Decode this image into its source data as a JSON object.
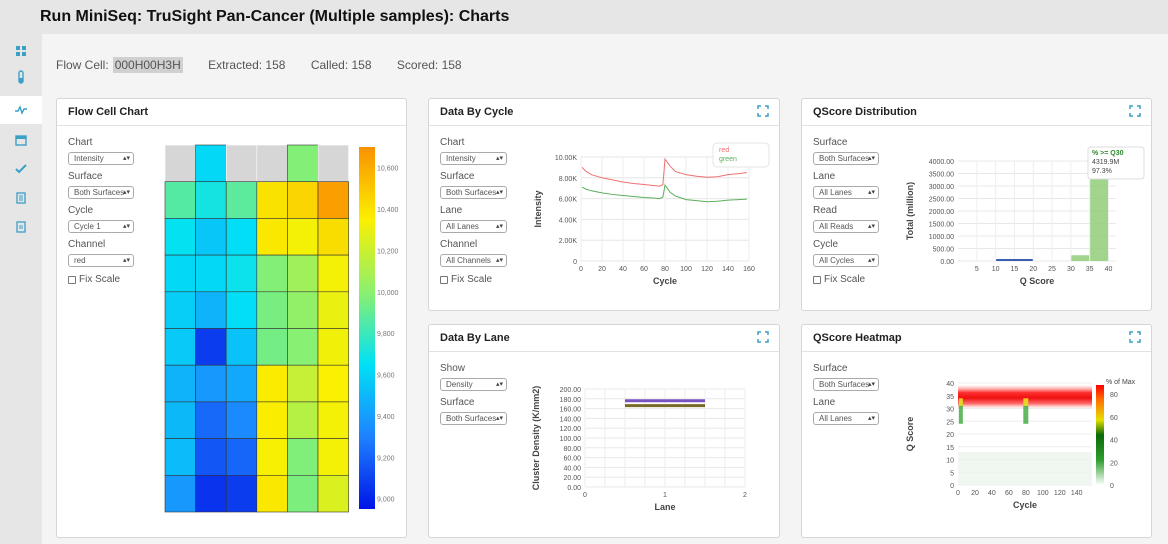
{
  "page": {
    "title": "Run MiniSeq: TruSight Pan-Cancer (Multiple samples): Charts"
  },
  "sidebar": {
    "items": [
      "dashboard-icon",
      "test-tube-icon",
      "charts-icon",
      "calendar-icon",
      "check-icon",
      "notes-icon",
      "document-icon"
    ]
  },
  "summary": {
    "flow_cell_label": "Flow Cell:",
    "flow_cell_value": "000H00H3H",
    "extracted": "Extracted: 158",
    "called": "Called: 158",
    "scored": "Scored: 158"
  },
  "flow_cell_chart": {
    "title": "Flow Cell Chart",
    "chart_label": "Chart",
    "chart_value": "Intensity",
    "surface_label": "Surface",
    "surface_value": "Both Surfaces",
    "cycle_label": "Cycle",
    "cycle_value": "Cycle 1",
    "channel_label": "Channel",
    "channel_value": "red",
    "fix_scale": "Fix Scale"
  },
  "data_by_cycle": {
    "title": "Data By Cycle",
    "chart_label": "Chart",
    "chart_value": "Intensity",
    "surface_label": "Surface",
    "surface_value": "Both Surfaces",
    "lane_label": "Lane",
    "lane_value": "All Lanes",
    "channel_label": "Channel",
    "channel_value": "All Channels",
    "fix_scale": "Fix Scale"
  },
  "qscore_distribution": {
    "title": "QScore Distribution",
    "surface_label": "Surface",
    "surface_value": "Both Surfaces",
    "lane_label": "Lane",
    "lane_value": "All Lanes",
    "read_label": "Read",
    "read_value": "All Reads",
    "cycle_label": "Cycle",
    "cycle_value": "All Cycles",
    "fix_scale": "Fix Scale"
  },
  "data_by_lane": {
    "title": "Data By Lane",
    "show_label": "Show",
    "show_value": "Density",
    "surface_label": "Surface",
    "surface_value": "Both Surfaces"
  },
  "qscore_heatmap": {
    "title": "QScore Heatmap",
    "surface_label": "Surface",
    "surface_value": "Both Surfaces",
    "lane_label": "Lane",
    "lane_value": "All Lanes"
  },
  "colors": {
    "accent": "#3aa0c8",
    "red_series": "#f07070",
    "green_series": "#5cae5c",
    "qscore_bar_low": "#3a5fb0",
    "qscore_bar_high": "#90cc78",
    "lane_series_1": "#7b53c1",
    "lane_series_2": "#7a6a2a"
  },
  "chart_data": [
    {
      "id": "flow_cell_heatmap",
      "type": "heatmap",
      "colorbar_ticks": [
        "10,600",
        "10,400",
        "10,200",
        "10,000",
        "9,800",
        "9,600",
        "9,400",
        "9,200",
        "9,000"
      ],
      "colorbar_range": [
        8950,
        10700
      ],
      "grid": [
        [
          null,
          9620,
          null,
          null,
          9980,
          null
        ],
        [
          9860,
          9700,
          9880,
          10400,
          10450,
          10650
        ],
        [
          9660,
          9550,
          9640,
          10380,
          10330,
          10420
        ],
        [
          9620,
          9620,
          9680,
          9980,
          10060,
          10330
        ],
        [
          9580,
          9480,
          9640,
          9950,
          10020,
          10300
        ],
        [
          9560,
          9080,
          9540,
          9940,
          9990,
          10320
        ],
        [
          9480,
          9380,
          9440,
          10370,
          10180,
          10350
        ],
        [
          9500,
          9220,
          9330,
          10360,
          10130,
          10330
        ],
        [
          9510,
          9160,
          9210,
          10340,
          9970,
          10330
        ],
        [
          9380,
          9050,
          9080,
          10380,
          9960,
          10250
        ]
      ]
    },
    {
      "id": "data_by_cycle",
      "type": "line",
      "xlabel": "Cycle",
      "ylabel": "Intensity",
      "xlim": [
        0,
        160
      ],
      "ylim": [
        0,
        10000
      ],
      "xticks": [
        "0",
        "20",
        "40",
        "60",
        "80",
        "100",
        "120",
        "140",
        "160"
      ],
      "yticks": [
        "0",
        "2.00K",
        "4.00K",
        "6.00K",
        "8.00K",
        "10.00K"
      ],
      "series": [
        {
          "name": "red",
          "x": [
            1,
            5,
            10,
            20,
            30,
            40,
            50,
            60,
            70,
            75,
            78,
            80,
            85,
            90,
            100,
            110,
            120,
            130,
            140,
            150,
            158
          ],
          "values": [
            9000,
            8600,
            8300,
            8000,
            7800,
            7600,
            7450,
            7350,
            7250,
            7200,
            7350,
            9800,
            9100,
            8600,
            8300,
            8150,
            8050,
            8100,
            8300,
            8400,
            8500
          ]
        },
        {
          "name": "green",
          "x": [
            1,
            5,
            10,
            20,
            30,
            40,
            50,
            60,
            70,
            75,
            78,
            80,
            85,
            90,
            100,
            110,
            120,
            130,
            140,
            150,
            158
          ],
          "values": [
            7100,
            6900,
            6750,
            6550,
            6400,
            6300,
            6200,
            6100,
            6050,
            6000,
            6150,
            7300,
            6600,
            6250,
            5900,
            5800,
            5700,
            5750,
            5850,
            5900,
            5950
          ]
        }
      ]
    },
    {
      "id": "qscore_distribution",
      "type": "bar",
      "xlabel": "Q Score",
      "ylabel": "Total (million)",
      "xlim": [
        0,
        42
      ],
      "ylim": [
        0,
        4000
      ],
      "xticks": [
        "5",
        "10",
        "15",
        "20",
        "25",
        "30",
        "35",
        "40"
      ],
      "yticks": [
        "0.00",
        "500.00",
        "1000.00",
        "1500.00",
        "2000.00",
        "2500.00",
        "3000.00",
        "3500.00",
        "4000.00"
      ],
      "bins": [
        {
          "from": 10,
          "to": 20,
          "value": 40,
          "class": "low"
        },
        {
          "from": 30,
          "to": 35,
          "value": 230,
          "class": "high"
        },
        {
          "from": 35,
          "to": 40,
          "value": 4319.9,
          "class": "high"
        }
      ],
      "annotation": {
        "line1": "% >= Q30",
        "line2": "4319.9M",
        "line3": "97.3%"
      }
    },
    {
      "id": "data_by_lane",
      "type": "line",
      "xlabel": "Lane",
      "ylabel": "Cluster Density (K/mm2)",
      "xlim": [
        0,
        2
      ],
      "ylim": [
        0,
        200
      ],
      "xticks": [
        "0",
        "1",
        "2"
      ],
      "yticks": [
        "0.00",
        "20.00",
        "40.00",
        "60.00",
        "80.00",
        "100.00",
        "120.00",
        "140.00",
        "160.00",
        "180.00",
        "200.00"
      ],
      "series": [
        {
          "x": [
            0.5,
            1.5
          ],
          "values": [
            176,
            176
          ]
        },
        {
          "x": [
            0.5,
            1.5
          ],
          "values": [
            166,
            166
          ]
        }
      ]
    },
    {
      "id": "qscore_heatmap",
      "type": "heatmap",
      "xlabel": "Cycle",
      "ylabel": "Q Score",
      "xlim": [
        0,
        158
      ],
      "ylim": [
        0,
        40
      ],
      "xticks": [
        "0",
        "20",
        "40",
        "60",
        "80",
        "100",
        "120",
        "140"
      ],
      "yticks": [
        "0",
        "5",
        "10",
        "15",
        "20",
        "25",
        "30",
        "35",
        "40"
      ],
      "legend_title": "% of Max",
      "legend_ticks": [
        "0",
        "20",
        "40",
        "60",
        "80"
      ]
    }
  ]
}
